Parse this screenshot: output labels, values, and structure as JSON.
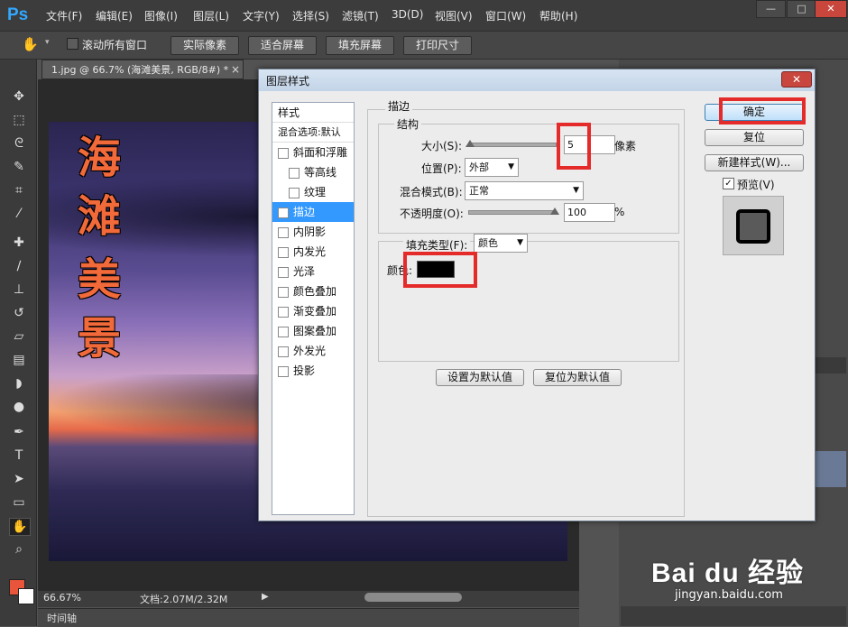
{
  "app": {
    "logo": "Ps",
    "menu": [
      "文件(F)",
      "编辑(E)",
      "图像(I)",
      "图层(L)",
      "文字(Y)",
      "选择(S)",
      "滤镜(T)",
      "3D(D)",
      "视图(V)",
      "窗口(W)",
      "帮助(H)"
    ],
    "window_buttons": {
      "minimize": "—",
      "maximize": "□",
      "close": "✕"
    }
  },
  "options_bar": {
    "scroll_all": "滚动所有窗口",
    "buttons": [
      "实际像素",
      "适合屏幕",
      "填充屏幕",
      "打印尺寸"
    ]
  },
  "document": {
    "tab_title": "1.jpg @ 66.7% (海滩美景, RGB/8#) *",
    "tab_close": "×",
    "text_layer": [
      "海",
      "滩",
      "美",
      "景"
    ],
    "zoom": "66.67%",
    "doc_size": "文档:2.07M/2.32M",
    "timeline_label": "时间轴"
  },
  "dialog": {
    "title": "图层样式",
    "close": "✕",
    "styles_header": "样式",
    "blend_options": "混合选项:默认",
    "style_items": [
      {
        "label": "斜面和浮雕",
        "checked": false,
        "indent": false
      },
      {
        "label": "等高线",
        "checked": false,
        "indent": true
      },
      {
        "label": "纹理",
        "checked": false,
        "indent": true
      },
      {
        "label": "描边",
        "checked": true,
        "indent": false,
        "selected": true
      },
      {
        "label": "内阴影",
        "checked": false,
        "indent": false
      },
      {
        "label": "内发光",
        "checked": false,
        "indent": false
      },
      {
        "label": "光泽",
        "checked": false,
        "indent": false
      },
      {
        "label": "颜色叠加",
        "checked": false,
        "indent": false
      },
      {
        "label": "渐变叠加",
        "checked": false,
        "indent": false
      },
      {
        "label": "图案叠加",
        "checked": false,
        "indent": false
      },
      {
        "label": "外发光",
        "checked": false,
        "indent": false
      },
      {
        "label": "投影",
        "checked": false,
        "indent": false
      }
    ],
    "stroke": {
      "section_title": "描边",
      "structure_title": "结构",
      "size_label": "大小(S):",
      "size_value": "5",
      "size_unit": "像素",
      "size_level": 0.02,
      "position_label": "位置(P):",
      "position_value": "外部",
      "blend_mode_label": "混合模式(B):",
      "blend_mode_value": "正常",
      "opacity_label": "不透明度(O):",
      "opacity_value": "100",
      "opacity_unit": "%",
      "opacity_level": 1.0,
      "fill_type_label": "填充类型(F):",
      "fill_type_value": "颜色",
      "color_label": "颜色:",
      "color": "#000000",
      "set_default": "设置为默认值",
      "reset_default": "复位为默认值"
    },
    "buttons": {
      "ok": "确定",
      "reset": "复位",
      "new_style": "新建样式(W)...",
      "preview_label": "预览(V)",
      "preview_checked": true
    }
  },
  "watermark": {
    "brand": "Bai du 经验",
    "url": "jingyan.baidu.com"
  },
  "colors": {
    "accent": "#31a8ff",
    "highlight": "#e52a2a",
    "foreground_swatch": "#e8553a",
    "background_swatch": "#ffffff"
  }
}
